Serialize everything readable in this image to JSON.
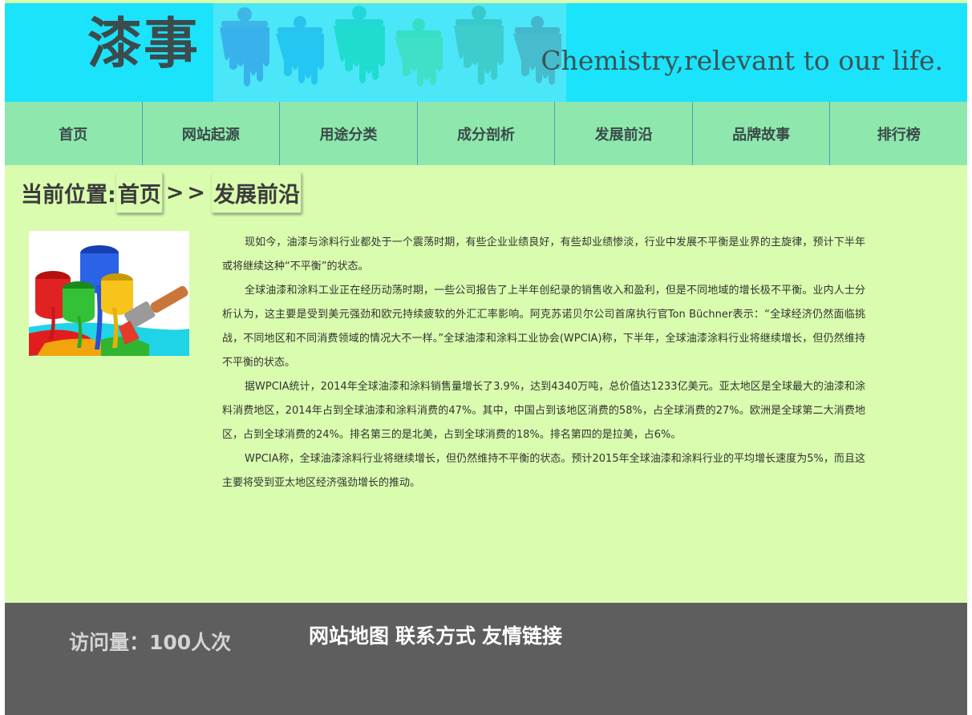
{
  "header": {
    "logo_text": "漆事",
    "slogan": "Chemistry,relevant to our life."
  },
  "nav": {
    "items": [
      {
        "label": "首页"
      },
      {
        "label": "网站起源"
      },
      {
        "label": "用途分类"
      },
      {
        "label": "成分剖析"
      },
      {
        "label": "发展前沿"
      },
      {
        "label": "品牌故事"
      },
      {
        "label": "排行榜"
      }
    ]
  },
  "breadcrumb": {
    "prefix": "当前位置:",
    "home": "首页",
    "separator": ">>",
    "current": "发展前沿"
  },
  "article": {
    "image_icon": "paint-buckets-illustration",
    "paragraphs": [
      "现如今，油漆与涂料行业都处于一个震荡时期，有些企业业绩良好，有些却业绩惨淡，行业中发展不平衡是业界的主旋律，预计下半年或将继续这种“不平衡”的状态。",
      "全球油漆和涂料工业正在经历动荡时期，一些公司报告了上半年创纪录的销售收入和盈利，但是不同地域的增长极不平衡。业内人士分析认为，这主要是受到美元强劲和欧元持续疲软的外汇汇率影响。阿克苏诺贝尔公司首席执行官Ton Büchner表示：“全球经济仍然面临挑战，不同地区和不同消费领域的情况大不一样。”全球油漆和涂料工业协会(WPCIA)称，下半年，全球油漆涂料行业将继续增长，但仍然维持不平衡的状态。",
      "据WPCIA统计，2014年全球油漆和涂料销售量增长了3.9%，达到4340万吨，总价值达1233亿美元。亚太地区是全球最大的油漆和涂料消费地区，2014年占到全球油漆和涂料消费的47%。其中，中国占到该地区消费的58%，占全球消费的27%。欧洲是全球第二大消费地区，占到全球消费的24%。排名第三的是北美，占到全球消费的18%。排名第四的是拉美，占6%。",
      "WPCIA称，全球油漆涂料行业将继续增长，但仍然维持不平衡的状态。预计2015年全球油漆和涂料行业的平均增长速度为5%，而且这主要将受到亚太地区经济强劲增长的推动。"
    ]
  },
  "footer": {
    "visits": "访问量：100人次",
    "links": [
      "网站地图",
      "联系方式",
      "友情链接"
    ]
  },
  "colors": {
    "header_bg": "#1be3fb",
    "nav_bg": "#8ee7ad",
    "content_bg": "#d9fcae",
    "footer_bg": "#5e5e5e"
  }
}
